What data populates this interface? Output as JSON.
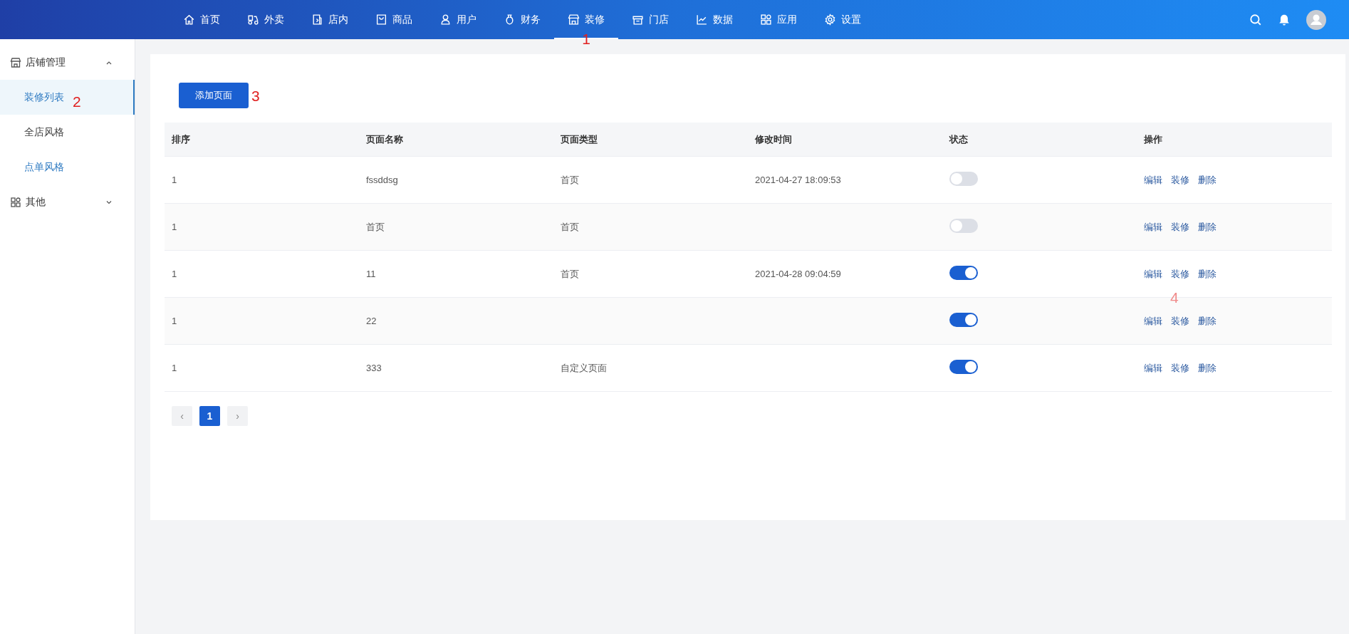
{
  "top_nav": {
    "items": [
      {
        "label": "首页",
        "selected": false
      },
      {
        "label": "外卖",
        "selected": false
      },
      {
        "label": "店内",
        "selected": false
      },
      {
        "label": "商品",
        "selected": false
      },
      {
        "label": "用户",
        "selected": false
      },
      {
        "label": "财务",
        "selected": false
      },
      {
        "label": "装修",
        "selected": true,
        "annotation": "1"
      },
      {
        "label": "门店",
        "selected": false
      },
      {
        "label": "数据",
        "selected": false
      },
      {
        "label": "应用",
        "selected": false
      },
      {
        "label": "设置",
        "selected": false
      }
    ]
  },
  "sidebar": {
    "groups": [
      {
        "label": "店铺管理",
        "expanded": true,
        "children": [
          {
            "label": "装修列表",
            "selected": true,
            "hovered": false,
            "annotation": "2"
          },
          {
            "label": "全店风格",
            "selected": false,
            "hovered": false
          },
          {
            "label": "点单风格",
            "selected": false,
            "hovered": true
          }
        ]
      },
      {
        "label": "其他",
        "expanded": false
      }
    ]
  },
  "add_button": {
    "label": "添加页面",
    "annotation": "3"
  },
  "table": {
    "columns": [
      "排序",
      "页面名称",
      "页面类型",
      "修改时间",
      "状态",
      "操作"
    ],
    "rows": [
      {
        "order": "1",
        "name": "fssddsg",
        "type": "首页",
        "modified": "2021-04-27 18:09:53",
        "on": false,
        "actions": [
          "编辑",
          "装修",
          "删除"
        ]
      },
      {
        "order": "1",
        "name": "首页",
        "type": "首页",
        "on": false,
        "actions": [
          "编辑",
          "装修",
          "删除"
        ]
      },
      {
        "order": "1",
        "name": "11",
        "type": "首页",
        "modified": "2021-04-28 09:04:59",
        "on": true,
        "actions": [
          "编辑",
          "装修",
          "删除"
        ],
        "annotation": "4"
      },
      {
        "order": "1",
        "name": "22",
        "on": true,
        "actions": [
          "编辑",
          "装修",
          "删除"
        ]
      },
      {
        "order": "1",
        "name": "333",
        "type": "自定义页面",
        "on": true,
        "actions": [
          "编辑",
          "装修",
          "删除"
        ]
      }
    ]
  },
  "pagination": {
    "prev": "‹",
    "pages": [
      {
        "label": "1",
        "selected": true
      }
    ],
    "next": "›"
  }
}
